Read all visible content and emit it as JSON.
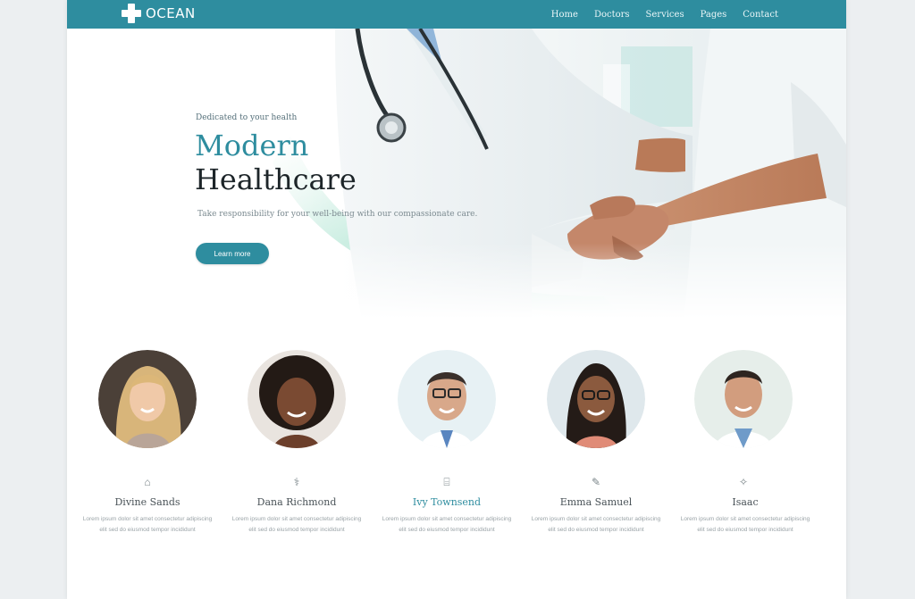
{
  "brand": {
    "name": "OCEAN"
  },
  "nav": {
    "items": [
      "Home",
      "Doctors",
      "Services",
      "Pages",
      "Contact"
    ]
  },
  "hero": {
    "eyebrow": "Dedicated to your health",
    "title_line1": "Modern",
    "title_line2": "Healthcare",
    "subtitle": "Take responsibility for your well-being with our compassionate care.",
    "cta": "Learn more"
  },
  "team": [
    {
      "name": "Divine Sands",
      "icon": "heart-icon",
      "accent": false,
      "desc": "Lorem ipsum dolor sit amet consectetur adipiscing elit sed do eiusmod tempor incididunt"
    },
    {
      "name": "Dana Richmond",
      "icon": "hospital-icon",
      "accent": false,
      "desc": "Lorem ipsum dolor sit amet consectetur adipiscing elit sed do eiusmod tempor incididunt"
    },
    {
      "name": "Ivy Townsend",
      "icon": "clipboard-icon",
      "accent": true,
      "desc": "Lorem ipsum dolor sit amet consectetur adipiscing elit sed do eiusmod tempor incididunt"
    },
    {
      "name": "Emma Samuel",
      "icon": "syringe-icon",
      "accent": false,
      "desc": "Lorem ipsum dolor sit amet consectetur adipiscing elit sed do eiusmod tempor incididunt"
    },
    {
      "name": "Isaac",
      "icon": "stethoscope-icon",
      "accent": false,
      "desc": "Lorem ipsum dolor sit amet consectetur adipiscing elit sed do eiusmod tempor incididunt"
    }
  ],
  "colors": {
    "primary": "#2e8d9f",
    "dark": "#1d2529",
    "mint": "#9fdccb"
  }
}
